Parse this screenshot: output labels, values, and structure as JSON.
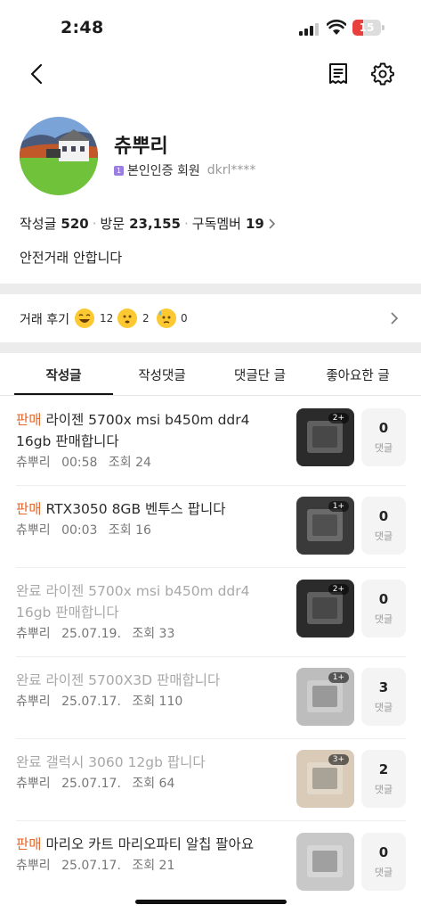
{
  "status_bar": {
    "time": "2:48",
    "battery": "15"
  },
  "profile": {
    "nickname": "츄뿌리",
    "verified_label": "본인인증 회원",
    "user_id": "dkrl****",
    "stats": [
      {
        "label": "작성글",
        "value": "520"
      },
      {
        "label": "방문",
        "value": "23,155"
      },
      {
        "label": "구독멤버",
        "value": "19"
      }
    ],
    "intro": "안전거래 안합니다"
  },
  "reviews": {
    "label": "거래 후기",
    "items": [
      {
        "icon": "laughing-face-icon",
        "count": "12"
      },
      {
        "icon": "neutral-face-icon",
        "count": "2"
      },
      {
        "icon": "sweat-face-icon",
        "count": "0"
      }
    ]
  },
  "tabs": [
    "작성글",
    "작성댓글",
    "댓글단 글",
    "좋아요한 글"
  ],
  "posts": [
    {
      "tag": "판매",
      "title": "라이젠 5700x msi b450m ddr4 16gb 판매합니다",
      "author": "츄뿌리",
      "time": "00:58",
      "views": "조회 24",
      "photo_count": "2+",
      "comments": "0",
      "comment_label": "댓글",
      "status": "sale"
    },
    {
      "tag": "판매",
      "title": "RTX3050 8GB 벤투스 팝니다",
      "author": "츄뿌리",
      "time": "00:03",
      "views": "조회 16",
      "photo_count": "1+",
      "comments": "0",
      "comment_label": "댓글",
      "status": "sale"
    },
    {
      "tag": "완료",
      "title": "라이젠 5700x msi b450m ddr4 16gb 판매합니다",
      "author": "츄뿌리",
      "time": "25.07.19.",
      "views": "조회 33",
      "photo_count": "2+",
      "comments": "0",
      "comment_label": "댓글",
      "status": "done"
    },
    {
      "tag": "완료",
      "title": "라이젠 5700X3D 판매합니다",
      "author": "츄뿌리",
      "time": "25.07.17.",
      "views": "조회 110",
      "photo_count": "1+",
      "comments": "3",
      "comment_label": "댓글",
      "status": "done"
    },
    {
      "tag": "완료",
      "title": "갤럭시 3060 12gb 팝니다",
      "author": "츄뿌리",
      "time": "25.07.17.",
      "views": "조회 64",
      "photo_count": "3+",
      "comments": "2",
      "comment_label": "댓글",
      "status": "done"
    },
    {
      "tag": "판매",
      "title": "마리오 카트 마리오파티 알칩 팔아요",
      "author": "츄뿌리",
      "time": "25.07.17.",
      "views": "조회 21",
      "photo_count": "",
      "comments": "0",
      "comment_label": "댓글",
      "status": "sale"
    }
  ],
  "colors": {
    "sale_tag": "#e5672a",
    "done_text": "#a8a8a8",
    "divider": "#ececec"
  }
}
